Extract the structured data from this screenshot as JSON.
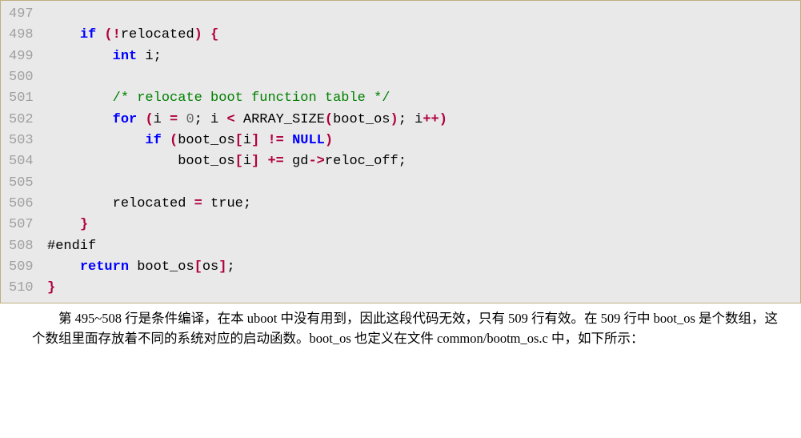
{
  "code": {
    "lines": [
      {
        "num": "497",
        "segs": [
          [
            "",
            " "
          ]
        ]
      },
      {
        "num": "498",
        "segs": [
          [
            "",
            "    "
          ],
          [
            "kw",
            "if"
          ],
          [
            "",
            " "
          ],
          [
            "op",
            "("
          ],
          [
            "op",
            "!"
          ],
          [
            "",
            "relocated"
          ],
          [
            "op",
            ")"
          ],
          [
            "",
            " "
          ],
          [
            "op",
            "{"
          ]
        ]
      },
      {
        "num": "499",
        "segs": [
          [
            "",
            "        "
          ],
          [
            "kw",
            "int"
          ],
          [
            "",
            " i;"
          ]
        ]
      },
      {
        "num": "500",
        "segs": [
          [
            "",
            " "
          ]
        ]
      },
      {
        "num": "501",
        "segs": [
          [
            "",
            "        "
          ],
          [
            "cm",
            "/* relocate boot function table */"
          ]
        ]
      },
      {
        "num": "502",
        "segs": [
          [
            "",
            "        "
          ],
          [
            "kw",
            "for"
          ],
          [
            "",
            " "
          ],
          [
            "op",
            "("
          ],
          [
            "",
            "i "
          ],
          [
            "op",
            "="
          ],
          [
            "",
            " "
          ],
          [
            "num2",
            "0"
          ],
          [
            "",
            "; i "
          ],
          [
            "op",
            "<"
          ],
          [
            "",
            " ARRAY_SIZE"
          ],
          [
            "op",
            "("
          ],
          [
            "",
            "boot_os"
          ],
          [
            "op",
            ")"
          ],
          [
            "",
            "; i"
          ],
          [
            "op",
            "++"
          ],
          [
            "op",
            ")"
          ]
        ]
      },
      {
        "num": "503",
        "segs": [
          [
            "",
            "            "
          ],
          [
            "kw",
            "if"
          ],
          [
            "",
            " "
          ],
          [
            "op",
            "("
          ],
          [
            "",
            "boot_os"
          ],
          [
            "op",
            "["
          ],
          [
            "",
            "i"
          ],
          [
            "op",
            "]"
          ],
          [
            "",
            " "
          ],
          [
            "op",
            "!="
          ],
          [
            "",
            " "
          ],
          [
            "kw",
            "NULL"
          ],
          [
            "op",
            ")"
          ]
        ]
      },
      {
        "num": "504",
        "segs": [
          [
            "",
            "                boot_os"
          ],
          [
            "op",
            "["
          ],
          [
            "",
            "i"
          ],
          [
            "op",
            "]"
          ],
          [
            "",
            " "
          ],
          [
            "op",
            "+="
          ],
          [
            "",
            " gd"
          ],
          [
            "op",
            "->"
          ],
          [
            "",
            "reloc_off;"
          ]
        ]
      },
      {
        "num": "505",
        "segs": [
          [
            "",
            " "
          ]
        ]
      },
      {
        "num": "506",
        "segs": [
          [
            "",
            "        relocated "
          ],
          [
            "op",
            "="
          ],
          [
            "",
            " true;"
          ]
        ]
      },
      {
        "num": "507",
        "segs": [
          [
            "",
            "    "
          ],
          [
            "op",
            "}"
          ]
        ]
      },
      {
        "num": "508",
        "segs": [
          [
            "",
            "#endif"
          ]
        ]
      },
      {
        "num": "509",
        "segs": [
          [
            "",
            "    "
          ],
          [
            "kw",
            "return"
          ],
          [
            "",
            " boot_os"
          ],
          [
            "op",
            "["
          ],
          [
            "",
            "os"
          ],
          [
            "op",
            "]"
          ],
          [
            "",
            ";"
          ]
        ]
      },
      {
        "num": "510",
        "segs": [
          [
            "op",
            "}"
          ]
        ]
      }
    ]
  },
  "para": {
    "p1": "第 495~508 行是条件编译，在本 uboot 中没有用到，因此这段代码无效，只有 509 行有效。在 509 行中 boot_os 是个数组，这个数组里面存放着不同的系统对应的启动函数。boot_os 也定义在文件 common/bootm_os.c 中，如下所示："
  }
}
